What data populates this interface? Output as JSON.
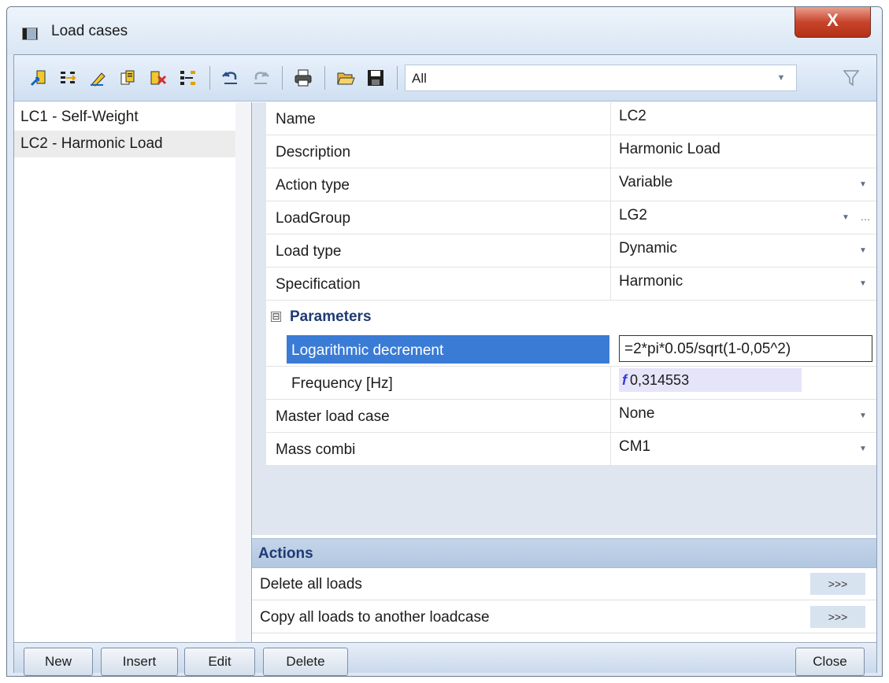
{
  "window": {
    "title": "Load cases",
    "close_glyph": "X"
  },
  "toolbar": {
    "icons": [
      "new-item-icon",
      "insert-icon",
      "edit-icon",
      "copy-icon",
      "delete-icon",
      "tree-icon",
      "undo-icon",
      "redo-icon",
      "print-icon",
      "open-icon",
      "save-icon"
    ],
    "filter_value": "All"
  },
  "list": {
    "items": [
      "LC1 - Self-Weight",
      "LC2 - Harmonic Load"
    ],
    "selected_index": 1
  },
  "properties": {
    "rows": [
      {
        "label": "Name",
        "value": "LC2"
      },
      {
        "label": "Description",
        "value": "Harmonic Load"
      },
      {
        "label": "Action type",
        "value": "Variable"
      },
      {
        "label": "LoadGroup",
        "value": "LG2"
      },
      {
        "label": "Load type",
        "value": "Dynamic"
      },
      {
        "label": "Specification",
        "value": "Harmonic"
      }
    ],
    "section": {
      "toggle": "⊟",
      "label": "Parameters"
    },
    "params": [
      {
        "label": "Logarithmic decrement",
        "value": "=2*pi*0.05/sqrt(1-0,05^2)"
      },
      {
        "label": "Frequency [Hz]",
        "value": "0,314553"
      }
    ],
    "rows_after": [
      {
        "label": "Master load case",
        "value": "None"
      },
      {
        "label": "Mass combi",
        "value": "CM1"
      }
    ]
  },
  "actions": {
    "header": "Actions",
    "items": [
      {
        "label": "Delete all loads",
        "button": ">>>"
      },
      {
        "label": "Copy all loads to another loadcase",
        "button": ">>>"
      }
    ]
  },
  "buttons": {
    "new": "New",
    "insert": "Insert",
    "edit": "Edit",
    "delete": "Delete",
    "close": "Close"
  },
  "colors": {
    "selection": "#3a7bd5",
    "section_text": "#1f3a74",
    "formula_bg": "#e6e4f8"
  }
}
